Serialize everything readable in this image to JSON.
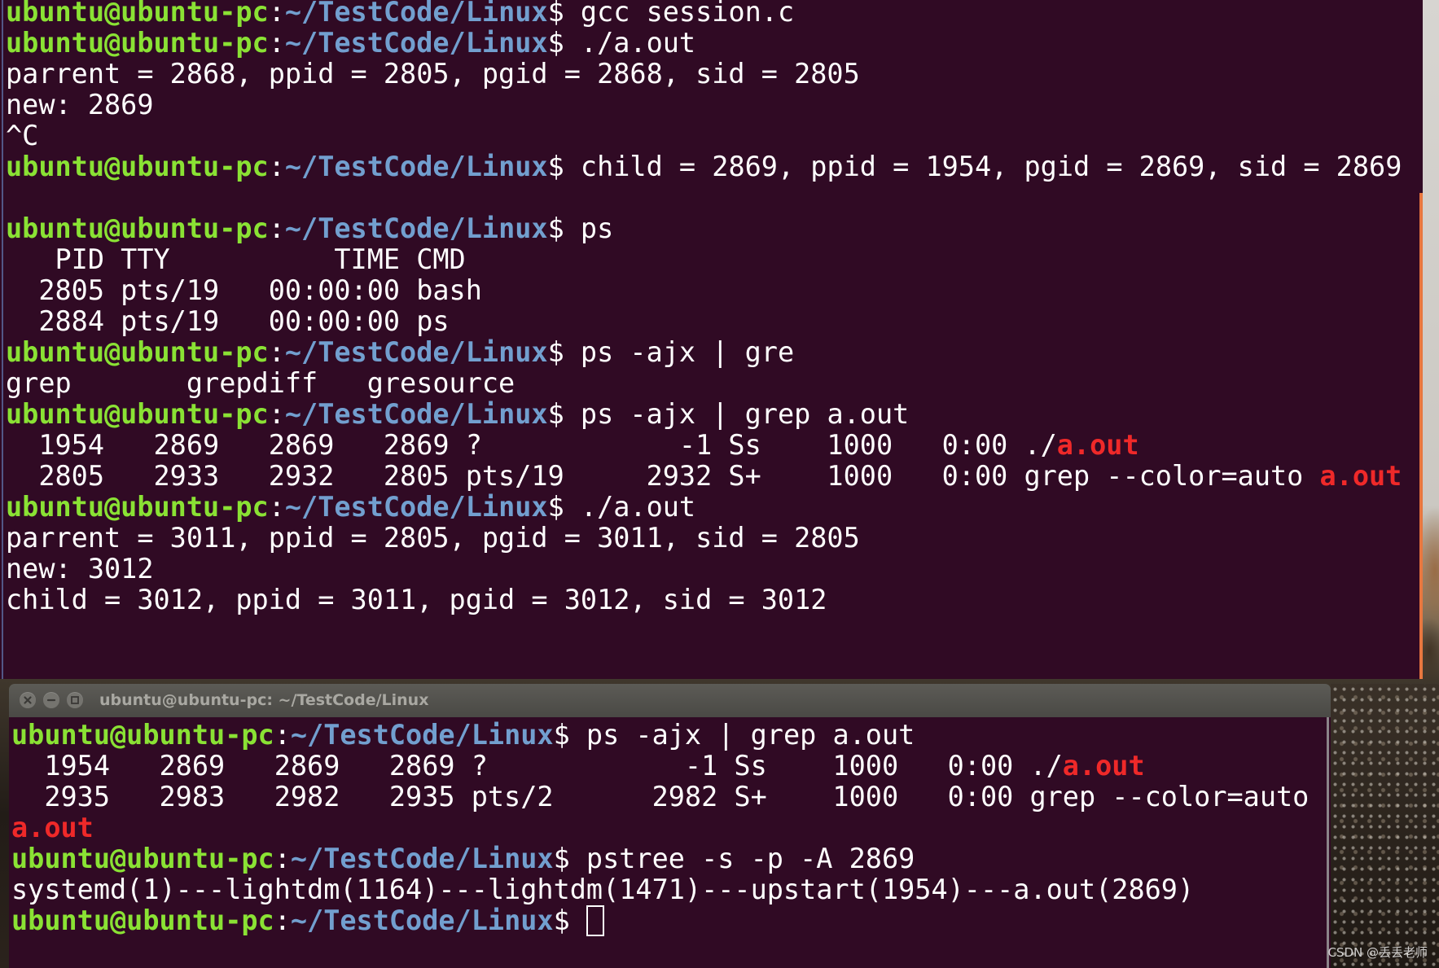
{
  "colors": {
    "terminal_background": "#300a24",
    "text": "#ffffff",
    "user_host": "#8ae234",
    "path": "#729fcf",
    "grep_match": "#ef2929",
    "scrollbar": "#e8773f"
  },
  "prompt": {
    "user_host": "ubuntu@ubuntu-pc",
    "colon": ":",
    "path": "~/TestCode/Linux",
    "dollar": "$ "
  },
  "top_terminal": {
    "lines": [
      {
        "prompt": true,
        "segments": [
          {
            "text": "gcc session.c"
          }
        ]
      },
      {
        "prompt": true,
        "segments": [
          {
            "text": "./a.out"
          }
        ]
      },
      {
        "segments": [
          {
            "text": "parrent = 2868, ppid = 2805, pgid = 2868, sid = 2805"
          }
        ]
      },
      {
        "segments": [
          {
            "text": "new: 2869"
          }
        ]
      },
      {
        "segments": [
          {
            "text": "^C"
          }
        ]
      },
      {
        "prompt": true,
        "segments": [
          {
            "text": "child = 2869, ppid = 1954, pgid = 2869, sid = 2869"
          }
        ]
      },
      {
        "segments": []
      },
      {
        "prompt": true,
        "segments": [
          {
            "text": "ps"
          }
        ]
      },
      {
        "segments": [
          {
            "text": "   PID TTY          TIME CMD"
          }
        ]
      },
      {
        "segments": [
          {
            "text": "  2805 pts/19   00:00:00 bash"
          }
        ]
      },
      {
        "segments": [
          {
            "text": "  2884 pts/19   00:00:00 ps"
          }
        ]
      },
      {
        "prompt": true,
        "segments": [
          {
            "text": "ps -ajx | gre"
          }
        ]
      },
      {
        "segments": [
          {
            "text": "grep       grepdiff   gresource"
          }
        ]
      },
      {
        "prompt": true,
        "segments": [
          {
            "text": "ps -ajx | grep a.out"
          }
        ]
      },
      {
        "segments": [
          {
            "text": "  1954   2869   2869   2869 ?            -1 Ss    1000   0:00 ./"
          },
          {
            "text": "a.out",
            "color": "#ef2929"
          }
        ]
      },
      {
        "segments": [
          {
            "text": "  2805   2933   2932   2805 pts/19     2932 S+    1000   0:00 grep --color=auto "
          },
          {
            "text": "a.out",
            "color": "#ef2929"
          }
        ]
      },
      {
        "prompt": true,
        "segments": [
          {
            "text": "./a.out"
          }
        ]
      },
      {
        "segments": [
          {
            "text": "parrent = 3011, ppid = 2805, pgid = 3011, sid = 2805"
          }
        ]
      },
      {
        "segments": [
          {
            "text": "new: 3012"
          }
        ]
      },
      {
        "segments": [
          {
            "text": "child = 3012, ppid = 3011, pgid = 3012, sid = 3012"
          }
        ]
      }
    ]
  },
  "bottom_terminal": {
    "title": "ubuntu@ubuntu-pc: ~/TestCode/Linux",
    "buttons": [
      {
        "icon": "close-icon"
      },
      {
        "icon": "minimize-icon"
      },
      {
        "icon": "maximize-icon"
      }
    ],
    "lines": [
      {
        "prompt": true,
        "segments": [
          {
            "text": "ps -ajx | grep a.out"
          }
        ]
      },
      {
        "segments": [
          {
            "text": "  1954   2869   2869   2869 ?            -1 Ss    1000   0:00 ./"
          },
          {
            "text": "a.out",
            "color": "#ef2929"
          }
        ]
      },
      {
        "segments": [
          {
            "text": "  2935   2983   2982   2935 pts/2      2982 S+    1000   0:00 grep --color=auto"
          }
        ]
      },
      {
        "segments": [
          {
            "text": "a.out",
            "color": "#ef2929"
          }
        ]
      },
      {
        "prompt": true,
        "segments": [
          {
            "text": "pstree -s -p -A 2869"
          }
        ]
      },
      {
        "segments": [
          {
            "text": "systemd(1)---lightdm(1164)---lightdm(1471)---upstart(1954)---a.out(2869)"
          }
        ]
      },
      {
        "prompt": true,
        "segments": [],
        "cursor": true
      }
    ]
  },
  "watermark": "CSDN @丢丢老师"
}
